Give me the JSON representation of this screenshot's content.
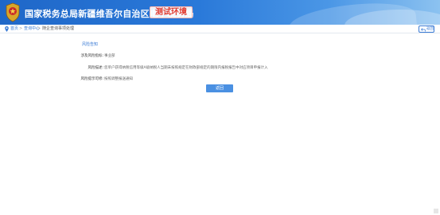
{
  "header": {
    "title": "国家税务总局新疆维吾尔自治区电子税务局",
    "env_badge": "测试环境",
    "colors": {
      "banner": "#2a79d9",
      "badge_text": "#e23a2e"
    }
  },
  "breadcrumb": {
    "home": "首页",
    "separator": ">",
    "level2": "查询中心",
    "level3": "随企查询事项处理"
  },
  "back_button": {
    "label": "返回",
    "icon": "back-arrow-icon"
  },
  "panel": {
    "section_title": "风险告知",
    "rows": [
      {
        "label": "涉及风险指标:",
        "value": "事业部"
      },
      {
        "label": "风险描述:",
        "value": "您单户获得纳税信用等级A级纳税人当期未按照规定在财政部规定的期限内报税报告中对应项目申报计入"
      },
      {
        "label": "风险提示可修:",
        "value": "按照调整报送通知"
      }
    ],
    "return_label": "返回"
  }
}
